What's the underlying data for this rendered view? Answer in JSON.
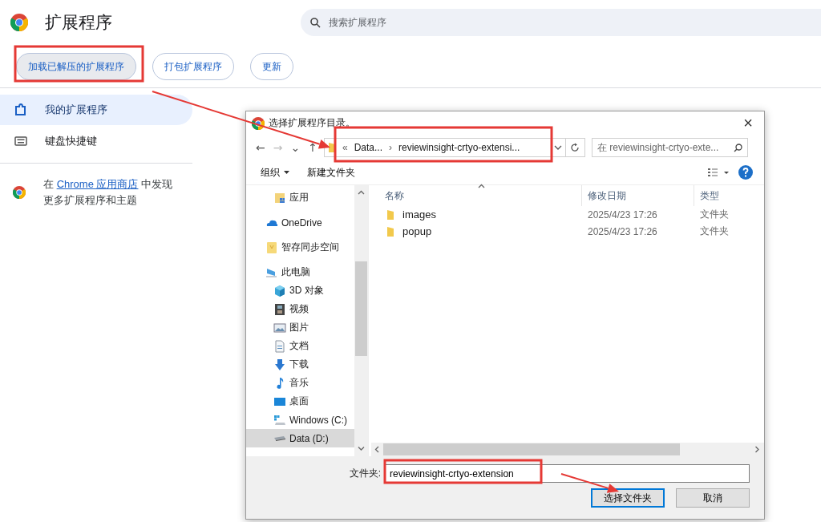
{
  "page": {
    "title": "扩展程序",
    "search": {
      "placeholder": "搜索扩展程序"
    }
  },
  "toolbar": [
    {
      "label": "加载已解压的扩展程序",
      "highlighted": true
    },
    {
      "label": "打包扩展程序",
      "highlighted": false
    },
    {
      "label": "更新",
      "highlighted": false
    }
  ],
  "sidebar": {
    "items": [
      {
        "label": "我的扩展程序",
        "kind": "extensions",
        "selected": true
      },
      {
        "label": "键盘快捷键",
        "kind": "keyboard",
        "selected": false
      }
    ],
    "store_promo": {
      "prefix": "在 ",
      "link": "Chrome 应用商店",
      "suffix": " 中发现",
      "line_2": "更多扩展程序和主题"
    }
  },
  "dialog": {
    "title": "选择扩展程序目录。",
    "close": "×",
    "nav_buttons": [
      "←",
      "→",
      "⌄",
      "↑"
    ],
    "address": {
      "prefix": "«",
      "crumbs": [
        "Data...",
        "reviewinsight-crtyo-extensi..."
      ],
      "separator": "›"
    },
    "search": {
      "placeholder": "在 reviewinsight-crtyo-exte..."
    },
    "commands": [
      {
        "label": "组织",
        "dropdown": true
      },
      {
        "label": "新建文件夹",
        "dropdown": false
      }
    ],
    "nav": [
      {
        "children": [
          {
            "label": "应用",
            "kind": "app-folder",
            "selected": false
          }
        ]
      },
      {
        "label": "OneDrive",
        "kind": "cloud",
        "selected": false
      },
      {
        "label": "智存同步空间",
        "kind": "sync-folder",
        "selected": false
      },
      {
        "label": "此电脑",
        "kind": "computer",
        "selected": false,
        "children": [
          {
            "label": "3D 对象",
            "kind": "cube",
            "selected": false
          },
          {
            "label": "视频",
            "kind": "film",
            "selected": false
          },
          {
            "label": "图片",
            "kind": "image",
            "selected": false
          },
          {
            "label": "文档",
            "kind": "document",
            "selected": false
          },
          {
            "label": "下载",
            "kind": "download",
            "selected": false
          },
          {
            "label": "音乐",
            "kind": "music",
            "selected": false
          },
          {
            "label": "桌面",
            "kind": "desktop",
            "selected": false
          },
          {
            "label": "Windows (C:)",
            "kind": "system-drive",
            "selected": false
          },
          {
            "label": "Data (D:)",
            "kind": "drive",
            "selected": true
          }
        ]
      }
    ],
    "columns": [
      "名称",
      "修改日期",
      "类型"
    ],
    "rows": [
      {
        "name": "images",
        "modified": "2025/4/23 17:26",
        "type": "文件夹"
      },
      {
        "name": "popup",
        "modified": "2025/4/23 17:26",
        "type": "文件夹"
      }
    ],
    "folder_label": "文件夹:",
    "folder_value": "reviewinsight-crtyo-extension",
    "buttons": [
      {
        "label": "选择文件夹",
        "default": true
      },
      {
        "label": "取消",
        "default": false
      }
    ]
  }
}
